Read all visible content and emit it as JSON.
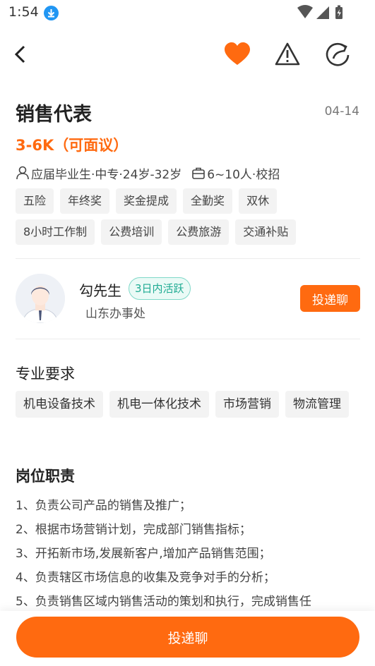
{
  "status_bar": {
    "time": "1:54"
  },
  "nav": {
    "back_icon": "back-arrow-icon",
    "favorite_icon": "heart-icon",
    "report_icon": "warning-icon",
    "share_icon": "share-icon",
    "favorite_color": "#ff6a10"
  },
  "job": {
    "title": "销售代表",
    "date": "04-14",
    "salary": "3-6K（可面议）",
    "requirements_text": "应届毕业生·中专·24岁-32岁",
    "company_text": "6~10人·校招",
    "benefits": [
      "五险",
      "年终奖",
      "奖金提成",
      "全勤奖",
      "双休",
      "8小时工作制",
      "公费培训",
      "公费旅游",
      "交通补贴"
    ]
  },
  "recruiter": {
    "name": "勾先生",
    "active_badge": "3日内活跃",
    "office": "山东办事处",
    "deliver_label": "投递聊"
  },
  "major": {
    "title": "专业要求",
    "tags": [
      "机电设备技术",
      "机电一体化技术",
      "市场营销",
      "物流管理"
    ]
  },
  "duties": {
    "title": "岗位职责",
    "items": [
      "1、负责公司产品的销售及推广；",
      "2、根据市场营销计划，完成部门销售指标；",
      "3、开拓新市场,发展新客户,增加产品销售范围；",
      "4、负责辖区市场信息的收集及竞争对手的分析；",
      "5、负责销售区域内销售活动的策划和执行，完成销售任"
    ]
  },
  "bottom": {
    "deliver_label": "投递聊"
  },
  "colors": {
    "accent": "#ff6a10",
    "active_green": "#1fab93"
  }
}
